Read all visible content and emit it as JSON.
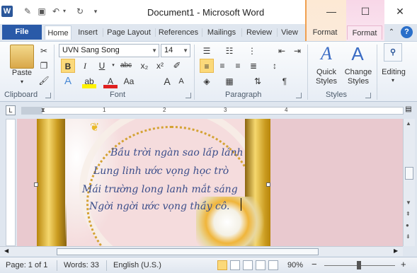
{
  "titlebar": {
    "title": "Document1 - Microsoft Word",
    "app_icon": "W",
    "qat_icons": [
      "save-icon",
      "undo-icon",
      "redo-icon",
      "customize-qat-icon"
    ],
    "minimize": "—",
    "maximize": "☐",
    "close": "✕"
  },
  "tabs": {
    "file": "File",
    "items": [
      "Home",
      "Insert",
      "Page Layout",
      "References",
      "Mailings",
      "Review",
      "View"
    ],
    "contextual": [
      "Format",
      "Format"
    ],
    "help": "?"
  },
  "ribbon": {
    "clipboard": {
      "paste": "Paste",
      "label": "Clipboard"
    },
    "font": {
      "font_name": "UVN Sang Song",
      "font_size": "14",
      "bold": "B",
      "italic": "I",
      "underline": "U",
      "strike": "abc",
      "subscript": "x₂",
      "superscript": "x²",
      "grow": "A",
      "shrink": "A",
      "case": "Aa",
      "clear": "A",
      "label": "Font"
    },
    "paragraph": {
      "label": "Paragraph",
      "show": "¶"
    },
    "styles": {
      "quick": "Quick",
      "quick2": "Styles",
      "change": "Change",
      "change2": "Styles",
      "label": "Styles"
    },
    "editing": {
      "label": "Editing"
    }
  },
  "ruler": {
    "numbers": [
      "1",
      "1",
      "2",
      "3",
      "4"
    ],
    "tab_selector": "L"
  },
  "document": {
    "lines": [
      "Bầu trời ngàn sao lấp lánh",
      "Lung linh ước vọng học trò",
      "Mái trường long lanh mắt sáng",
      "Ngời ngời ước vọng thầy cô."
    ]
  },
  "statusbar": {
    "page": "Page: 1 of 1",
    "words": "Words: 33",
    "language": "English (U.S.)",
    "zoom": "90%",
    "zoom_minus": "−",
    "zoom_plus": "+"
  }
}
